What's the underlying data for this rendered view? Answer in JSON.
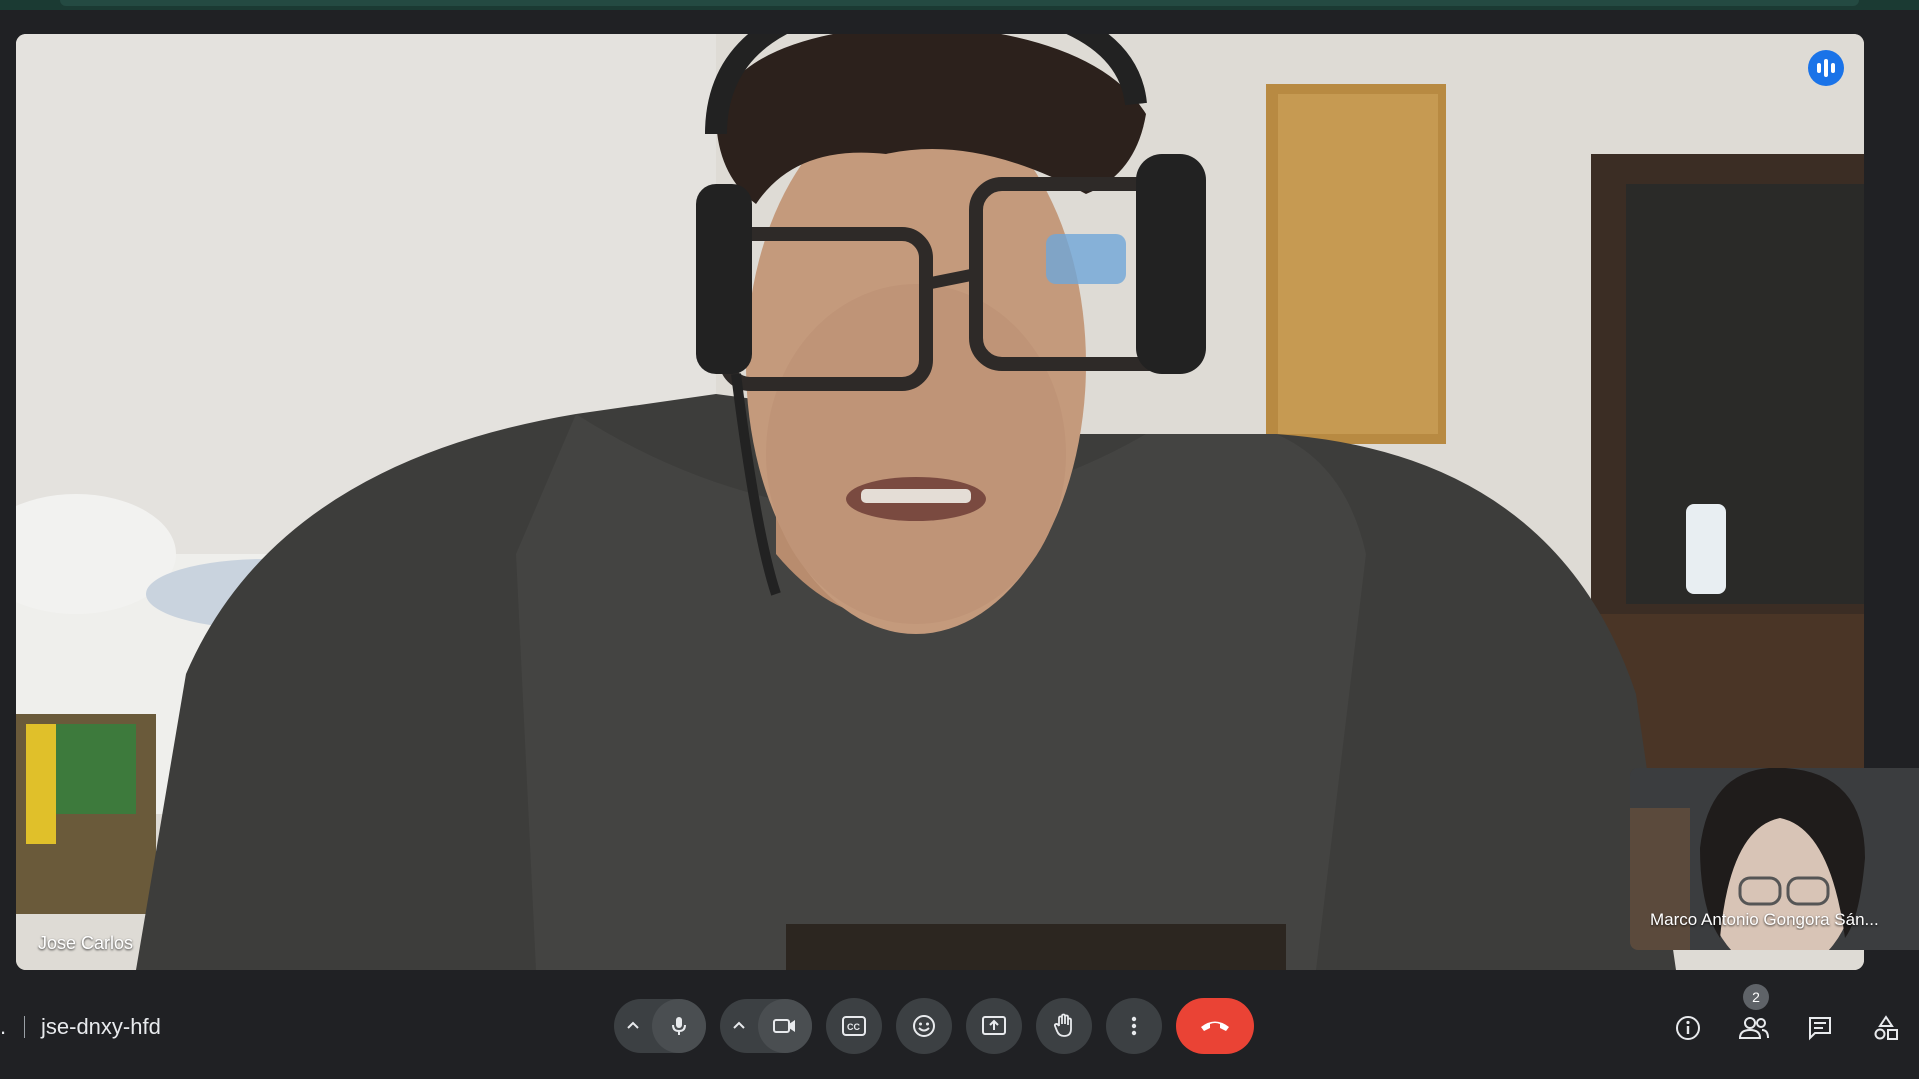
{
  "main_participant": {
    "name": "Jose Carlos"
  },
  "self_participant": {
    "name": "Marco Antonio Gongora Sán..."
  },
  "meeting": {
    "code": "jse-dnxy-hfd",
    "time_fragment": "."
  },
  "controls": {
    "mic": {
      "icon": "mic-icon"
    },
    "camera": {
      "icon": "videocam-icon"
    },
    "captions": {
      "icon": "captions-icon"
    },
    "reactions": {
      "icon": "emoji-icon"
    },
    "present": {
      "icon": "present-screen-icon"
    },
    "raise_hand": {
      "icon": "hand-icon"
    },
    "more": {
      "icon": "more-vert-icon"
    },
    "leave": {
      "icon": "call-end-icon"
    }
  },
  "side_controls": {
    "people_count": "2",
    "info": {
      "icon": "info-icon"
    },
    "people": {
      "icon": "people-icon"
    },
    "chat": {
      "icon": "chat-icon"
    },
    "activities": {
      "icon": "shapes-icon"
    }
  },
  "colors": {
    "bar": "#202124",
    "button": "#3c4043",
    "hangup": "#ea4335",
    "accent": "#1a73e8"
  }
}
